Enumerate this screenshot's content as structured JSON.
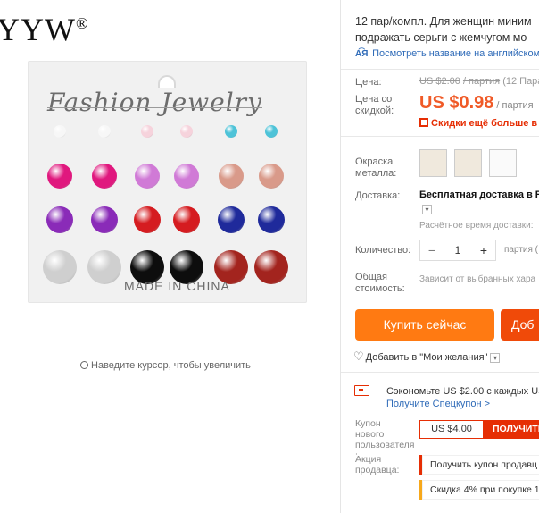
{
  "gallery": {
    "brand": "YYW",
    "brand_mark": "®",
    "card_title": "Fashion Jewelry",
    "card_footer": "MADE IN CHINA",
    "zoom_hint": "Наведите курсор, чтобы увеличить"
  },
  "product": {
    "title_line1": "12 пар/компл. Для женщин миним",
    "title_line2": "подражать серьги с жемчугом мо",
    "translate_icon": "A͡Я",
    "translate_link": "Посмотреть название на английском"
  },
  "price": {
    "label": "Цена:",
    "old_value": "US $2.00",
    "old_unit": "/ партия",
    "old_suffix": "(12 Пара",
    "discount_label": "Цена со скидкой:",
    "value": "US $0.98",
    "unit": "/ партия",
    "promo": "Скидки ещё больше в пр"
  },
  "options": {
    "color_label": "Окраска металла:",
    "delivery_label": "Доставка:",
    "delivery_value": "Бесплатная доставка в Ru",
    "delivery_toggle": "▾",
    "delivery_time": "Расчётное время доставки:",
    "quantity_label": "Количество:",
    "quantity_minus": "−",
    "quantity_value": "1",
    "quantity_plus": "+",
    "quantity_unit": "партия (",
    "total_label": "Общая стоимость:",
    "total_value": "Зависит от выбранных хара"
  },
  "actions": {
    "buy_now": "Купить сейчас",
    "add_to_cart": "Доб",
    "wishlist": "Добавить в \"Мои желания\"",
    "wishlist_toggle": "▾"
  },
  "coupons": {
    "save_text": "Сэкономьте US $2.00 с каждых US $",
    "special_coupon": "Получите Спецкупон >",
    "new_user_label": "Купон нового пользователя :",
    "new_user_amount": "US $4.00",
    "new_user_button": "ПОЛУЧИТЬ",
    "seller_promo_label": "Акция продавца:",
    "seller_promo_1": "Получить купон продавц",
    "seller_promo_2": "Скидка 4% при покупке 1"
  },
  "colors": {
    "accent_orange": "#ff7a12",
    "accent_red": "#e62e04",
    "link_blue": "#2f6bb8",
    "price_orange": "#f05a27"
  }
}
